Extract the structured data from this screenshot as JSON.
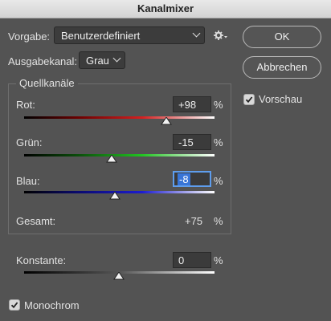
{
  "window": {
    "title": "Kanalmixer"
  },
  "preset": {
    "label": "Vorgabe:",
    "value": "Benutzerdefiniert"
  },
  "output": {
    "label": "Ausgabekanal:",
    "value": "Grau"
  },
  "buttons": {
    "ok": "OK",
    "cancel": "Abbrechen"
  },
  "preview": {
    "label": "Vorschau",
    "checked": true
  },
  "sources": {
    "title": "Quellkanäle",
    "red": {
      "label": "Rot:",
      "value": "+98",
      "unit": "%",
      "percent": 98
    },
    "green": {
      "label": "Grün:",
      "value": "-15",
      "unit": "%",
      "percent": -15
    },
    "blue": {
      "label": "Blau:",
      "value": "-8",
      "unit": "%",
      "percent": -8
    },
    "total": {
      "label": "Gesamt:",
      "value": "+75",
      "unit": "%"
    }
  },
  "constant": {
    "label": "Konstante:",
    "value": "0",
    "unit": "%",
    "percent": 0
  },
  "monochrome": {
    "label": "Monochrom",
    "checked": true
  },
  "colors": {
    "red": "#d42020",
    "green": "#22c422",
    "blue": "#1c1cd0",
    "focus": "#3875d7"
  }
}
